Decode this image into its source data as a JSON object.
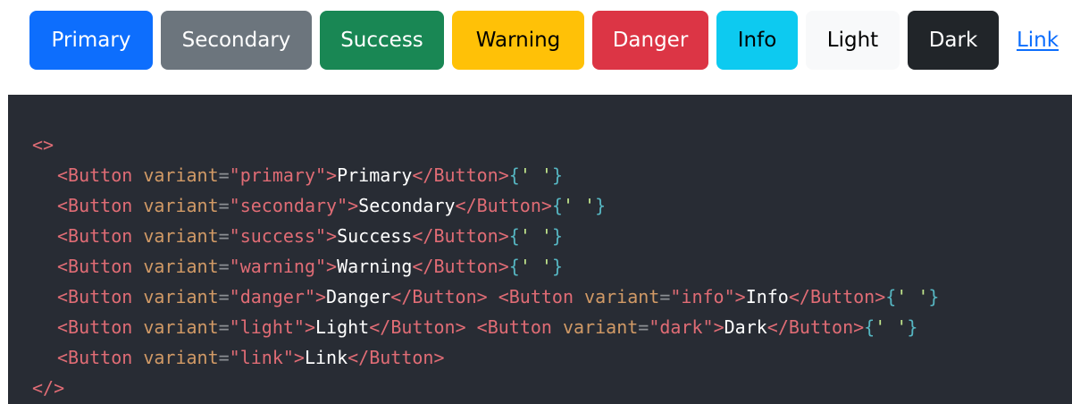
{
  "buttons": {
    "primary": "Primary",
    "secondary": "Secondary",
    "success": "Success",
    "warning": "Warning",
    "danger": "Danger",
    "info": "Info",
    "light": "Light",
    "dark": "Dark",
    "link": "Link"
  },
  "colors": {
    "primary": "#0d6efd",
    "secondary": "#6c757d",
    "success": "#198754",
    "warning": "#ffc107",
    "danger": "#dc3545",
    "info": "#0dcaf0",
    "light": "#f8f9fa",
    "dark": "#212529",
    "code_background": "#282c34"
  },
  "code": {
    "fragment_open": "<>",
    "fragment_close": "</>",
    "lines": [
      [
        {
          "t": "<Button ",
          "c": "tag"
        },
        {
          "t": "variant",
          "c": "attr"
        },
        {
          "t": "=",
          "c": "eq"
        },
        {
          "t": "\"primary\"",
          "c": "str"
        },
        {
          "t": ">",
          "c": "tag"
        },
        {
          "t": "Primary",
          "c": "text"
        },
        {
          "t": "</Button>",
          "c": "tag"
        },
        {
          "t": "{",
          "c": "brace"
        },
        {
          "t": "' '",
          "c": "space"
        },
        {
          "t": "}",
          "c": "brace"
        }
      ],
      [
        {
          "t": "<Button ",
          "c": "tag"
        },
        {
          "t": "variant",
          "c": "attr"
        },
        {
          "t": "=",
          "c": "eq"
        },
        {
          "t": "\"secondary\"",
          "c": "str"
        },
        {
          "t": ">",
          "c": "tag"
        },
        {
          "t": "Secondary",
          "c": "text"
        },
        {
          "t": "</Button>",
          "c": "tag"
        },
        {
          "t": "{",
          "c": "brace"
        },
        {
          "t": "' '",
          "c": "space"
        },
        {
          "t": "}",
          "c": "brace"
        }
      ],
      [
        {
          "t": "<Button ",
          "c": "tag"
        },
        {
          "t": "variant",
          "c": "attr"
        },
        {
          "t": "=",
          "c": "eq"
        },
        {
          "t": "\"success\"",
          "c": "str"
        },
        {
          "t": ">",
          "c": "tag"
        },
        {
          "t": "Success",
          "c": "text"
        },
        {
          "t": "</Button>",
          "c": "tag"
        },
        {
          "t": "{",
          "c": "brace"
        },
        {
          "t": "' '",
          "c": "space"
        },
        {
          "t": "}",
          "c": "brace"
        }
      ],
      [
        {
          "t": "<Button ",
          "c": "tag"
        },
        {
          "t": "variant",
          "c": "attr"
        },
        {
          "t": "=",
          "c": "eq"
        },
        {
          "t": "\"warning\"",
          "c": "str"
        },
        {
          "t": ">",
          "c": "tag"
        },
        {
          "t": "Warning",
          "c": "text"
        },
        {
          "t": "</Button>",
          "c": "tag"
        },
        {
          "t": "{",
          "c": "brace"
        },
        {
          "t": "' '",
          "c": "space"
        },
        {
          "t": "}",
          "c": "brace"
        }
      ],
      [
        {
          "t": "<Button ",
          "c": "tag"
        },
        {
          "t": "variant",
          "c": "attr"
        },
        {
          "t": "=",
          "c": "eq"
        },
        {
          "t": "\"danger\"",
          "c": "str"
        },
        {
          "t": ">",
          "c": "tag"
        },
        {
          "t": "Danger",
          "c": "text"
        },
        {
          "t": "</Button>",
          "c": "tag"
        },
        {
          "t": " ",
          "c": "text"
        },
        {
          "t": "<Button ",
          "c": "tag"
        },
        {
          "t": "variant",
          "c": "attr"
        },
        {
          "t": "=",
          "c": "eq"
        },
        {
          "t": "\"info\"",
          "c": "str"
        },
        {
          "t": ">",
          "c": "tag"
        },
        {
          "t": "Info",
          "c": "text"
        },
        {
          "t": "</Button>",
          "c": "tag"
        },
        {
          "t": "{",
          "c": "brace"
        },
        {
          "t": "' '",
          "c": "space"
        },
        {
          "t": "}",
          "c": "brace"
        }
      ],
      [
        {
          "t": "<Button ",
          "c": "tag"
        },
        {
          "t": "variant",
          "c": "attr"
        },
        {
          "t": "=",
          "c": "eq"
        },
        {
          "t": "\"light\"",
          "c": "str"
        },
        {
          "t": ">",
          "c": "tag"
        },
        {
          "t": "Light",
          "c": "text"
        },
        {
          "t": "</Button>",
          "c": "tag"
        },
        {
          "t": " ",
          "c": "text"
        },
        {
          "t": "<Button ",
          "c": "tag"
        },
        {
          "t": "variant",
          "c": "attr"
        },
        {
          "t": "=",
          "c": "eq"
        },
        {
          "t": "\"dark\"",
          "c": "str"
        },
        {
          "t": ">",
          "c": "tag"
        },
        {
          "t": "Dark",
          "c": "text"
        },
        {
          "t": "</Button>",
          "c": "tag"
        },
        {
          "t": "{",
          "c": "brace"
        },
        {
          "t": "' '",
          "c": "space"
        },
        {
          "t": "}",
          "c": "brace"
        }
      ],
      [
        {
          "t": "<Button ",
          "c": "tag"
        },
        {
          "t": "variant",
          "c": "attr"
        },
        {
          "t": "=",
          "c": "eq"
        },
        {
          "t": "\"link\"",
          "c": "str"
        },
        {
          "t": ">",
          "c": "tag"
        },
        {
          "t": "Link",
          "c": "text"
        },
        {
          "t": "</Button>",
          "c": "tag"
        }
      ]
    ]
  }
}
